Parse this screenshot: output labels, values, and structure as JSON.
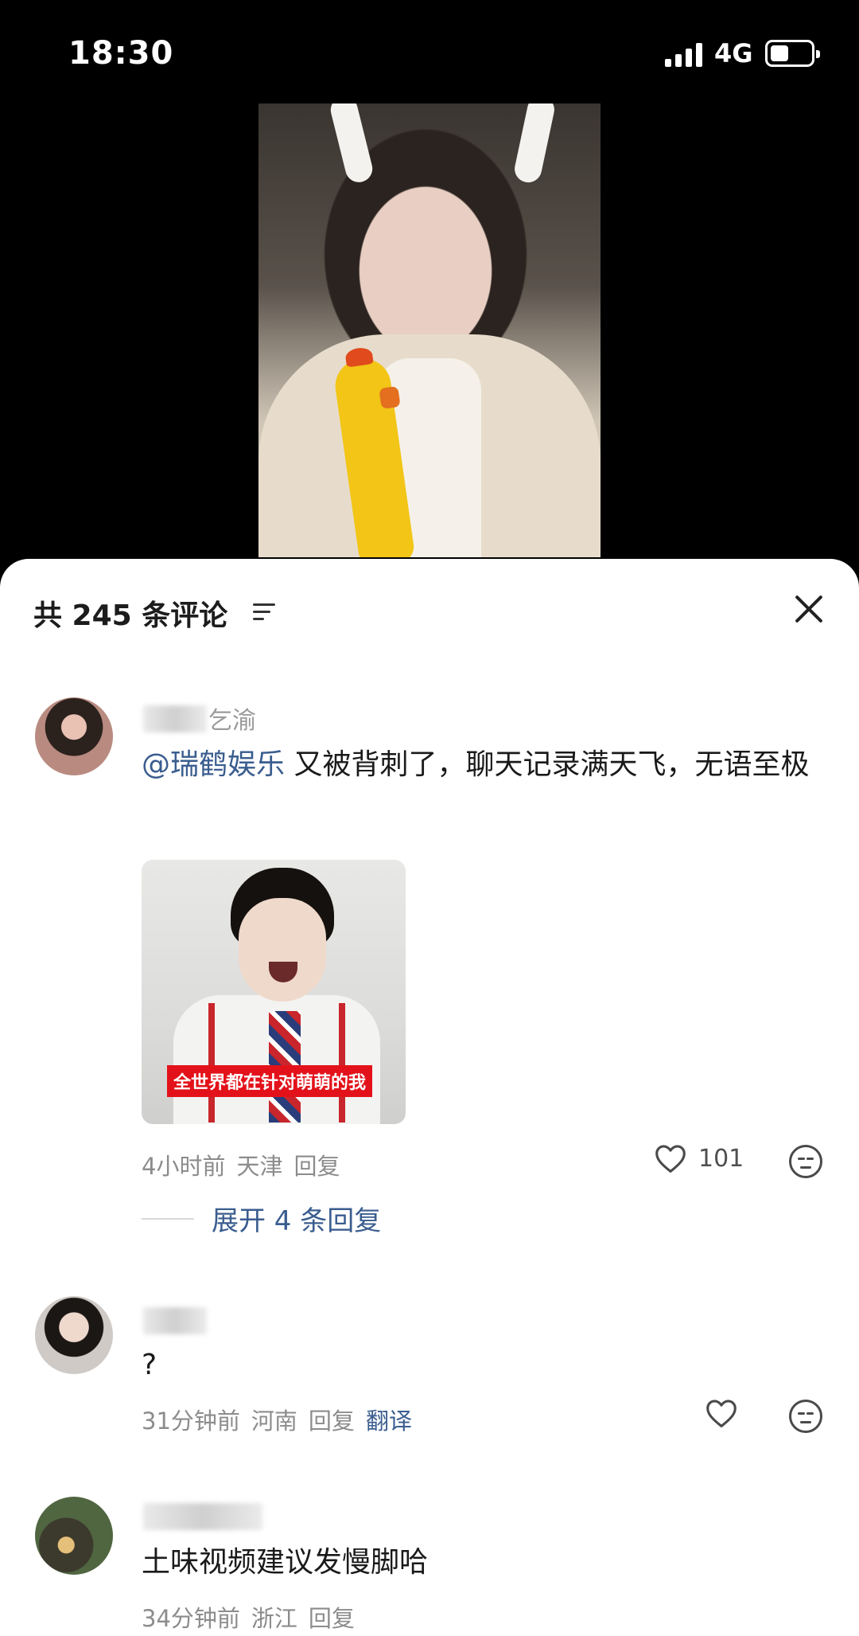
{
  "status_bar": {
    "time": "18:30",
    "network": "4G",
    "icons": [
      "signal-icon",
      "battery-icon"
    ]
  },
  "video": {
    "description_icon": "video-frame"
  },
  "comment_sheet": {
    "title": "共 245 条评论",
    "sort_icon": "sort-icon",
    "close_icon": "close-icon",
    "comments": [
      {
        "username": "乞渝",
        "mention": "@瑞鹤娱乐",
        "text": " 又被背刺了，聊天记录满天飞，无语至极",
        "sticker_caption": "全世界都在针对萌萌的我",
        "time": "4小时前",
        "location": "天津",
        "reply_label": "回复",
        "likes": "101",
        "expand_label": "展开 4 条回复"
      },
      {
        "username": "",
        "text": "?",
        "time": "31分钟前",
        "location": "河南",
        "reply_label": "回复",
        "translate_label": "翻译"
      },
      {
        "username": "",
        "text": "土味视频建议发慢脚哈",
        "time": "34分钟前",
        "location": "浙江",
        "reply_label": "回复"
      }
    ]
  }
}
